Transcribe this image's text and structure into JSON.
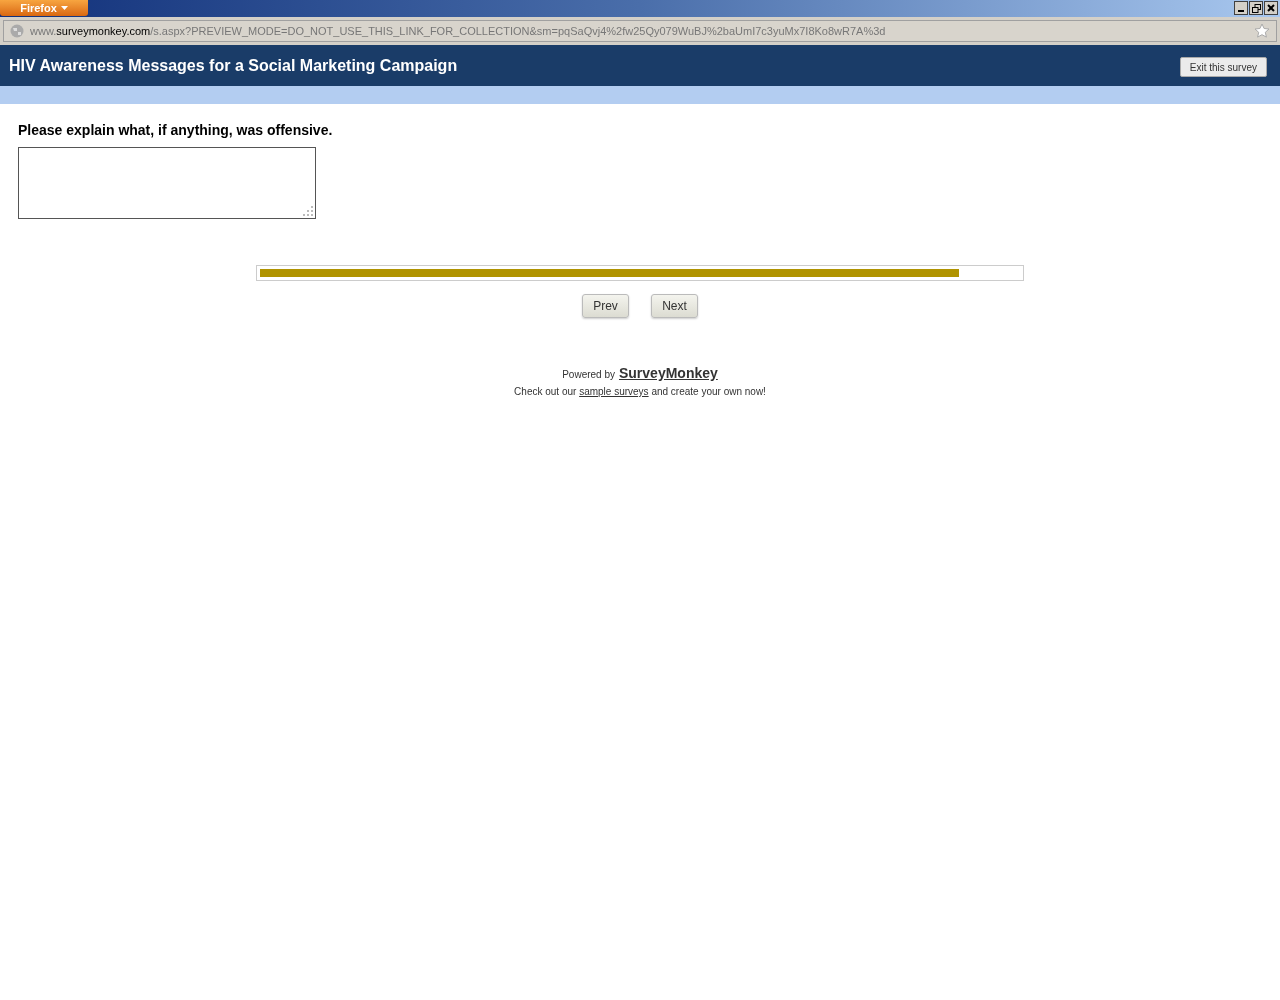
{
  "browser": {
    "menu_button": "Firefox",
    "url": "www.**surveymonkey.com**/s.aspx?PREVIEW_MODE=DO_NOT_USE_THIS_LINK_FOR_COLLECTION&sm=pqSaQvj4%2fw25Qy079WuBJ%2baUmI7c3yuMx7I8Ko8wR7A%3d"
  },
  "header": {
    "title": "HIV Awareness Messages for a Social Marketing Campaign",
    "exit_button": "Exit this survey"
  },
  "question": {
    "text": "Please explain what, if anything, was offensive."
  },
  "progress": {
    "level": 0.92
  },
  "buttons": [
    "Prev",
    "Next"
  ],
  "footer": {
    "powered_by": "Powered by",
    "brand_link": "SurveyMonkey",
    "line_before": "Check out our ",
    "line_link": "sample surveys",
    "line_after": " and create your own now!"
  }
}
